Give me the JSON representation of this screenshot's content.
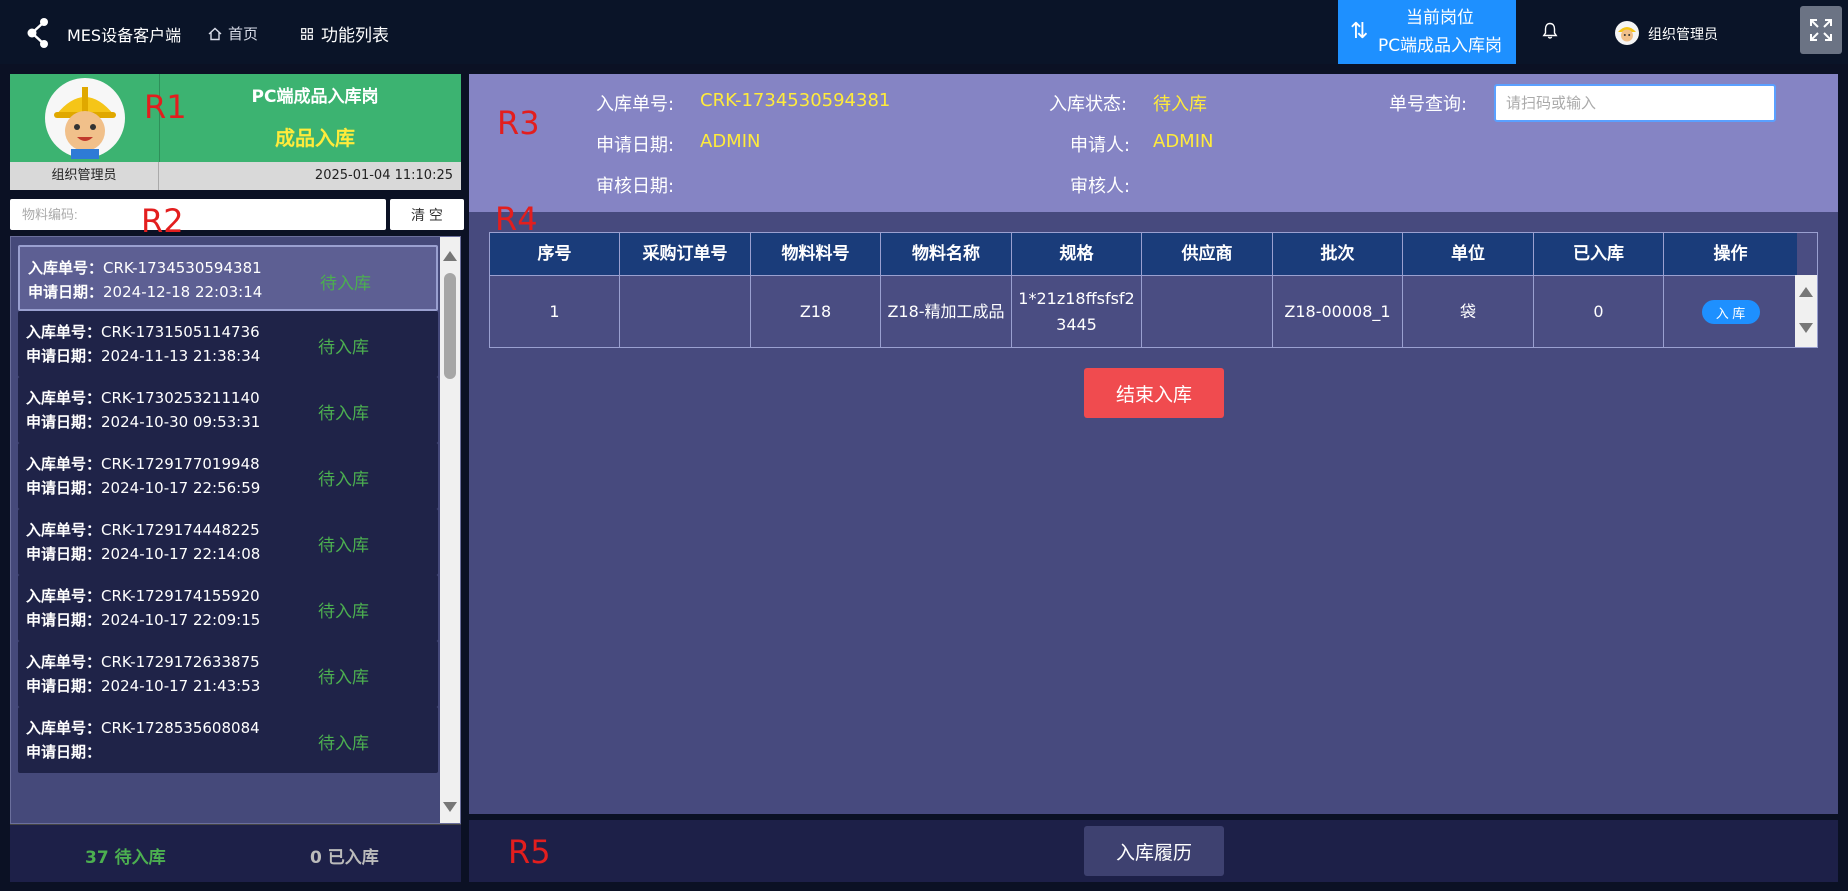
{
  "header": {
    "app_name": "MES设备客户端",
    "nav_home": "首页",
    "nav_funcs": "功能列表",
    "post_label": "当前岗位",
    "post_name": "PC端成品入库岗",
    "user_name": "组织管理员"
  },
  "left": {
    "post_title": "PC端成品入库岗",
    "page_title": "成品入库",
    "role": "组织管理员",
    "datetime": "2025-01-04 11:10:25",
    "material_placeholder": "物料编码:",
    "clear_label": "清 空",
    "order_label": "入库单号：",
    "date_label": "申请日期：",
    "items": [
      {
        "order": "CRK-1734530594381",
        "date": "2024-12-18 22:03:14",
        "status": "待入库"
      },
      {
        "order": "CRK-1731505114736",
        "date": "2024-11-13 21:38:34",
        "status": "待入库"
      },
      {
        "order": "CRK-1730253211140",
        "date": "2024-10-30 09:53:31",
        "status": "待入库"
      },
      {
        "order": "CRK-1729177019948",
        "date": "2024-10-17 22:56:59",
        "status": "待入库"
      },
      {
        "order": "CRK-1729174448225",
        "date": "2024-10-17 22:14:08",
        "status": "待入库"
      },
      {
        "order": "CRK-1729174155920",
        "date": "2024-10-17 22:09:15",
        "status": "待入库"
      },
      {
        "order": "CRK-1729172633875",
        "date": "2024-10-17 21:43:53",
        "status": "待入库"
      },
      {
        "order": "CRK-1728535608084",
        "date": "",
        "status": "待入库"
      }
    ],
    "pending_count": "37 待入库",
    "done_count": "0 已入库"
  },
  "info": {
    "order_label": "入库单号:",
    "order_value": "CRK-1734530594381",
    "status_label": "入库状态:",
    "status_value": "待入库",
    "query_label": "单号查询:",
    "query_placeholder": "请扫码或输入",
    "apply_date_label": "申请日期:",
    "apply_date_value": "ADMIN",
    "applicant_label": "申请人:",
    "applicant_value": "ADMIN",
    "review_date_label": "审核日期:",
    "reviewer_label": "审核人:"
  },
  "table": {
    "headers": [
      "序号",
      "采购订单号",
      "物料料号",
      "物料名称",
      "规格",
      "供应商",
      "批次",
      "单位",
      "已入库",
      "操作"
    ],
    "rows": [
      {
        "idx": "1",
        "po": "",
        "code": "Z18",
        "name": "Z18-精加工成品",
        "spec": "1*21z18ffsfsf23445",
        "supplier": "",
        "batch": "Z18-00008_1",
        "unit": "袋",
        "stocked": "0",
        "action": "入 库"
      }
    ]
  },
  "buttons": {
    "end": "结束入库",
    "history": "入库履历"
  },
  "regions": [
    "R1",
    "R2",
    "R3",
    "R4",
    "R5"
  ]
}
